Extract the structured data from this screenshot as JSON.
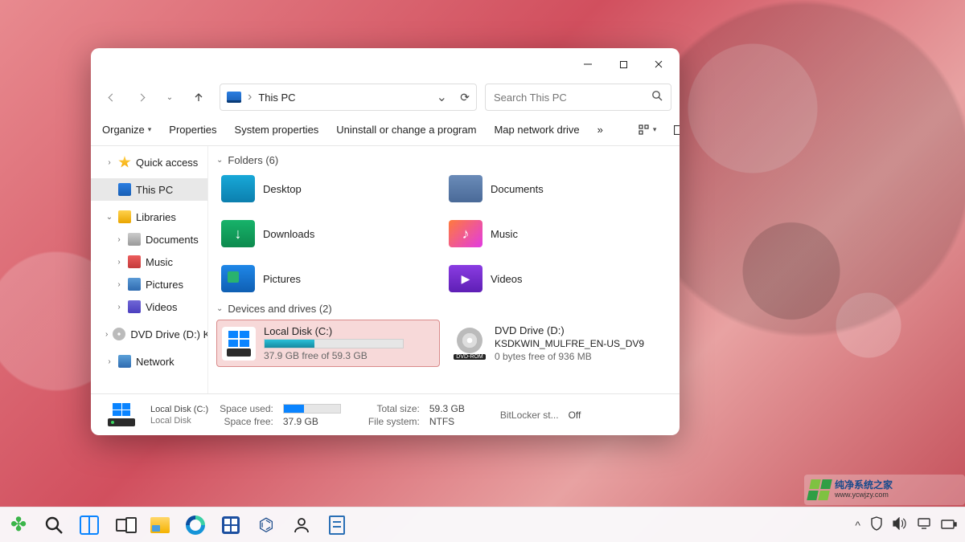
{
  "window": {
    "title": "This PC",
    "address_path": "This PC",
    "search_placeholder": "Search This PC"
  },
  "commandbar": {
    "organize": "Organize",
    "properties": "Properties",
    "system_properties": "System properties",
    "uninstall": "Uninstall or change a program",
    "map_drive": "Map network drive",
    "overflow_glyph": "»"
  },
  "sidebar": {
    "quick_access": "Quick access",
    "this_pc": "This PC",
    "libraries": "Libraries",
    "lib_documents": "Documents",
    "lib_music": "Music",
    "lib_pictures": "Pictures",
    "lib_videos": "Videos",
    "dvd_drive": "DVD Drive (D:) KSDK",
    "network": "Network"
  },
  "main": {
    "folders_header": "Folders (6)",
    "folders": {
      "desktop": "Desktop",
      "documents": "Documents",
      "downloads": "Downloads",
      "music": "Music",
      "pictures": "Pictures",
      "videos": "Videos"
    },
    "drives_header": "Devices and drives (2)",
    "drive_c": {
      "name": "Local Disk (C:)",
      "free_text": "37.9 GB free of 59.3 GB",
      "used_percent": 36
    },
    "drive_d": {
      "name": "DVD Drive (D:)",
      "label": "KSDKWIN_MULFRE_EN-US_DV9",
      "free_text": "0 bytes free of 936 MB",
      "dvd_badge": "DVD-ROM"
    }
  },
  "details": {
    "sel_name": "Local Disk (C:)",
    "sel_type": "Local Disk",
    "space_used_label": "Space used:",
    "space_free_label": "Space free:",
    "space_free_value": "37.9 GB",
    "total_size_label": "Total size:",
    "total_size_value": "59.3 GB",
    "filesystem_label": "File system:",
    "filesystem_value": "NTFS",
    "bitlocker_label": "BitLocker st...",
    "bitlocker_value": "Off",
    "used_percent": 36
  },
  "taskbar": {
    "tray_chevron": "^"
  },
  "watermark": {
    "title": "纯净系统之家",
    "url": "www.ycwjzy.com"
  }
}
